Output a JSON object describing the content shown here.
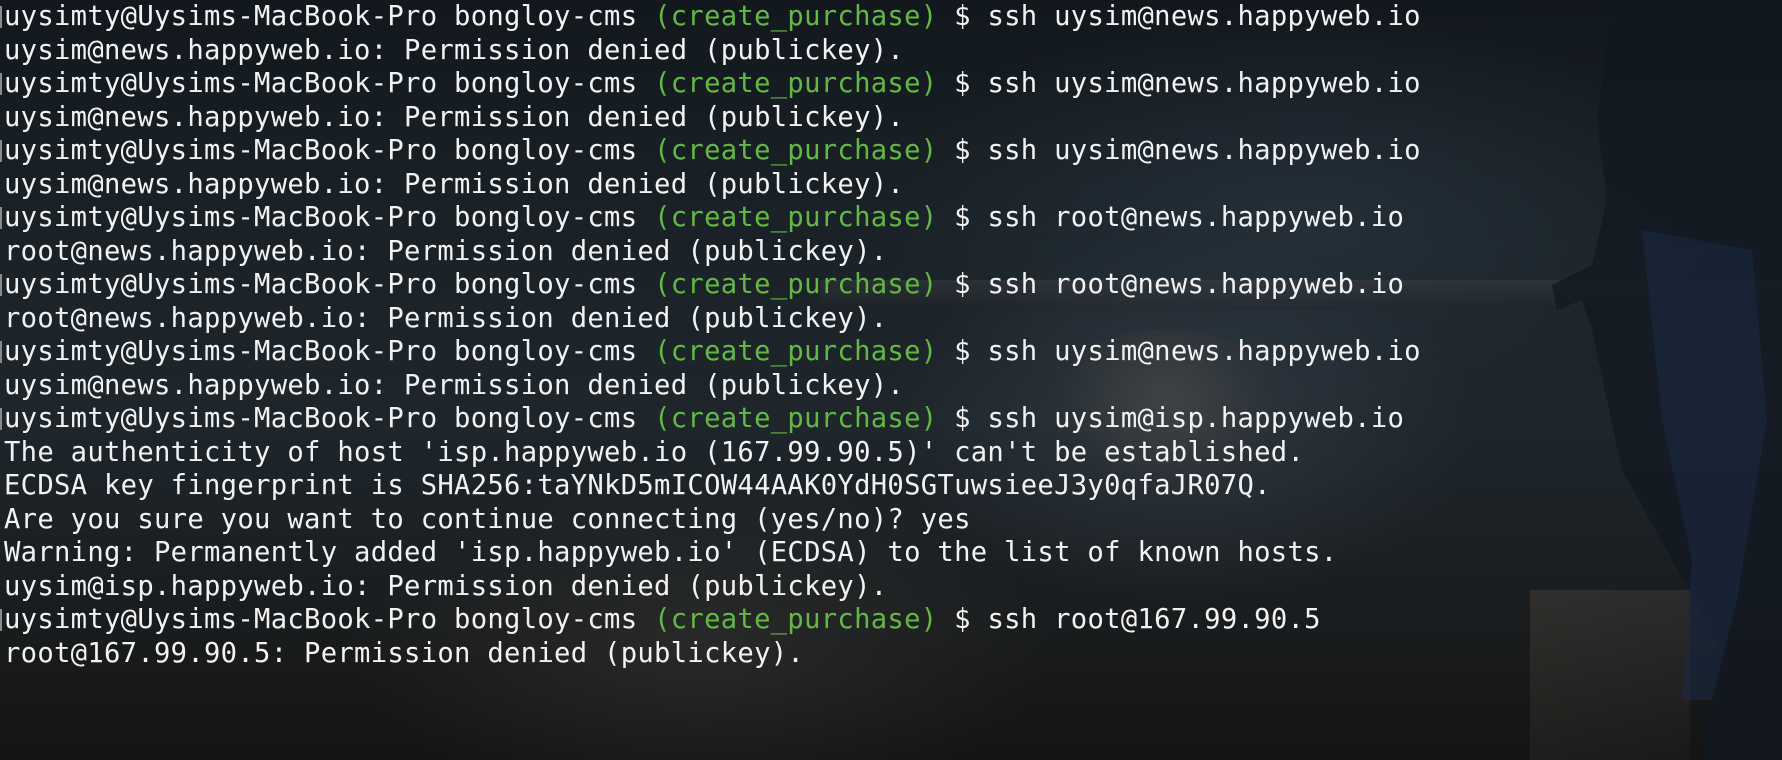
{
  "terminal": {
    "colors": {
      "text": "#f2f2f2",
      "branch": "#63b845",
      "background": "#1a2228"
    },
    "prompt": {
      "user_host_dir": "uysimty@Uysims-MacBook-Pro bongloy-cms",
      "branch": "(create_purchase)",
      "symbol": "$"
    },
    "lines": [
      {
        "type": "prompt",
        "command": "ssh uysim@news.happyweb.io"
      },
      {
        "type": "output",
        "text": "uysim@news.happyweb.io: Permission denied (publickey)."
      },
      {
        "type": "prompt",
        "command": "ssh uysim@news.happyweb.io"
      },
      {
        "type": "output",
        "text": "uysim@news.happyweb.io: Permission denied (publickey)."
      },
      {
        "type": "prompt",
        "command": "ssh uysim@news.happyweb.io"
      },
      {
        "type": "output",
        "text": "uysim@news.happyweb.io: Permission denied (publickey)."
      },
      {
        "type": "prompt",
        "command": "ssh root@news.happyweb.io"
      },
      {
        "type": "output",
        "text": "root@news.happyweb.io: Permission denied (publickey)."
      },
      {
        "type": "prompt",
        "command": "ssh root@news.happyweb.io"
      },
      {
        "type": "output",
        "text": "root@news.happyweb.io: Permission denied (publickey)."
      },
      {
        "type": "prompt",
        "command": "ssh uysim@news.happyweb.io"
      },
      {
        "type": "output",
        "text": "uysim@news.happyweb.io: Permission denied (publickey)."
      },
      {
        "type": "prompt",
        "command": "ssh uysim@isp.happyweb.io"
      },
      {
        "type": "output",
        "text": "The authenticity of host 'isp.happyweb.io (167.99.90.5)' can't be established."
      },
      {
        "type": "output",
        "text": "ECDSA key fingerprint is SHA256:taYNkD5mICOW44AAK0YdH0SGTuwsieeJ3y0qfaJR07Q."
      },
      {
        "type": "output",
        "text": "Are you sure you want to continue connecting (yes/no)? yes"
      },
      {
        "type": "output",
        "text": "Warning: Permanently added 'isp.happyweb.io' (ECDSA) to the list of known hosts."
      },
      {
        "type": "output",
        "text": "uysim@isp.happyweb.io: Permission denied (publickey)."
      },
      {
        "type": "prompt",
        "command": "ssh root@167.99.90.5"
      },
      {
        "type": "output",
        "text": "root@167.99.90.5: Permission denied (publickey)."
      }
    ]
  }
}
